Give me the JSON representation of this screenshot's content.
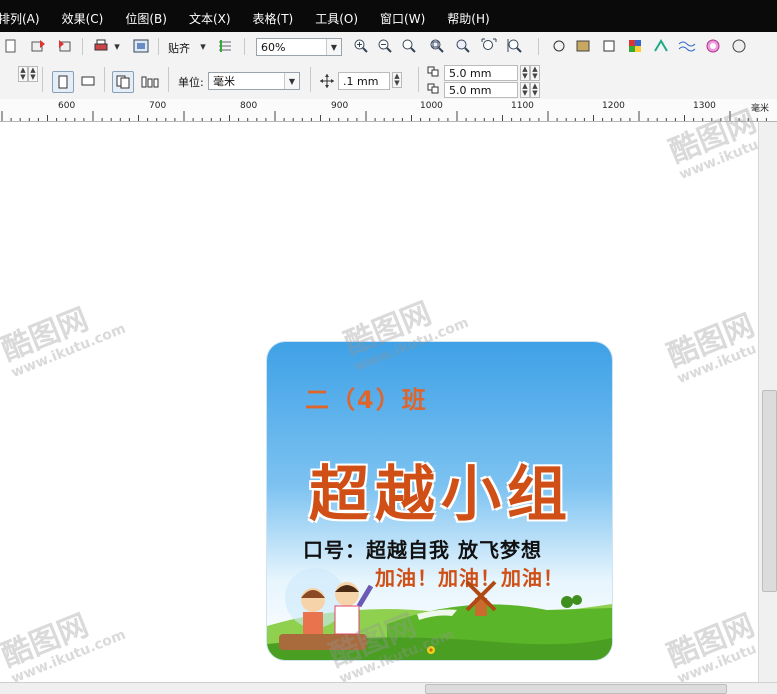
{
  "menu": {
    "items": [
      "排列(A)",
      "效果(C)",
      "位图(B)",
      "文本(X)",
      "表格(T)",
      "工具(O)",
      "窗口(W)",
      "帮助(H)"
    ]
  },
  "toolbar1": {
    "snap_label": "贴齐",
    "zoom_value": "60%"
  },
  "toolbar2": {
    "unit_label": "单位:",
    "unit_value": "毫米",
    "nudge_value": ".1 mm",
    "dup_x_value": "5.0 mm",
    "dup_y_value": "5.0 mm"
  },
  "ruler": {
    "ticks": [
      "600",
      "700",
      "800",
      "900",
      "1000",
      "1100",
      "1200",
      "1300"
    ],
    "unit": "毫米"
  },
  "sign": {
    "class_name": "二（4）班",
    "group_name": "超越小组",
    "slogan_line1": "口号：超越自我 放飞梦想",
    "slogan_line2": "加油！加油！加油！"
  },
  "watermark": {
    "brand": "酷图网",
    "url": "www.ikutu.com"
  },
  "colors": {
    "menubar_bg": "#0a0a0a",
    "sign_text_orange": "#cf4f16",
    "sky_top": "#3fa1e6",
    "grass": "#5bb528"
  },
  "icons": [
    "new-icon",
    "import-icon",
    "export-icon",
    "print-icon",
    "snap-icon",
    "zoom-in-icon",
    "zoom-out-icon",
    "page-portrait-icon",
    "page-landscape-icon",
    "nudge-icon",
    "dup-x-icon",
    "dup-y-icon",
    "windmill-icon"
  ]
}
